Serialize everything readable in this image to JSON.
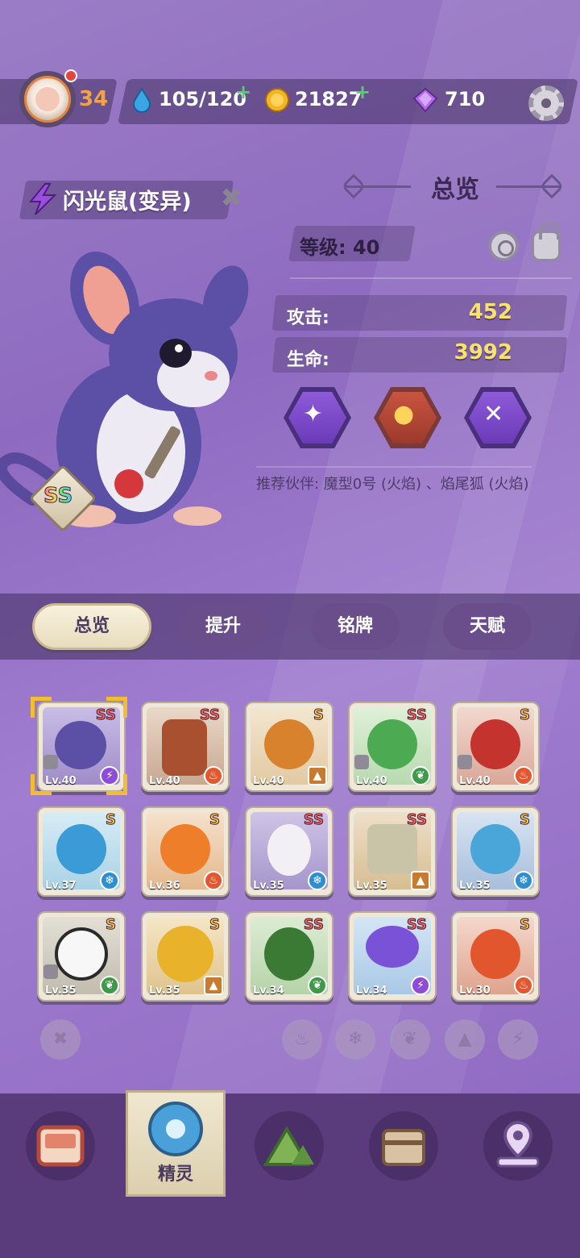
{
  "header": {
    "player_level": "34",
    "stamina": "105/120",
    "coins": "21827",
    "gems": "710",
    "plus": "+"
  },
  "pet": {
    "name": "闪光鼠(变异)",
    "grade": "SS",
    "close": "✖"
  },
  "overview": {
    "title": "总览",
    "level_label": "等级: 40",
    "attack_label": "攻击:",
    "attack_value": "452",
    "hp_label": "生命:",
    "hp_value": "3992",
    "recommend": "推荐伙伴: 魔型0号 (火焰) 、焰尾狐 (火焰)"
  },
  "tabs": [
    "总览",
    "提升",
    "铭牌",
    "天赋"
  ],
  "cards": [
    {
      "grade": "SS",
      "lv": "Lv.40"
    },
    {
      "grade": "SS",
      "lv": "Lv.40"
    },
    {
      "grade": "S",
      "lv": "Lv.40"
    },
    {
      "grade": "SS",
      "lv": "Lv.40"
    },
    {
      "grade": "S",
      "lv": "Lv.40"
    },
    {
      "grade": "S",
      "lv": "Lv.37"
    },
    {
      "grade": "S",
      "lv": "Lv.36"
    },
    {
      "grade": "SS",
      "lv": "Lv.35"
    },
    {
      "grade": "SS",
      "lv": "Lv.35"
    },
    {
      "grade": "S",
      "lv": "Lv.35"
    },
    {
      "grade": "S",
      "lv": "Lv.35"
    },
    {
      "grade": "S",
      "lv": "Lv.35"
    },
    {
      "grade": "SS",
      "lv": "Lv.34"
    },
    {
      "grade": "SS",
      "lv": "Lv.34"
    },
    {
      "grade": "S",
      "lv": "Lv.30"
    }
  ],
  "nav": {
    "active_label": "精灵"
  }
}
